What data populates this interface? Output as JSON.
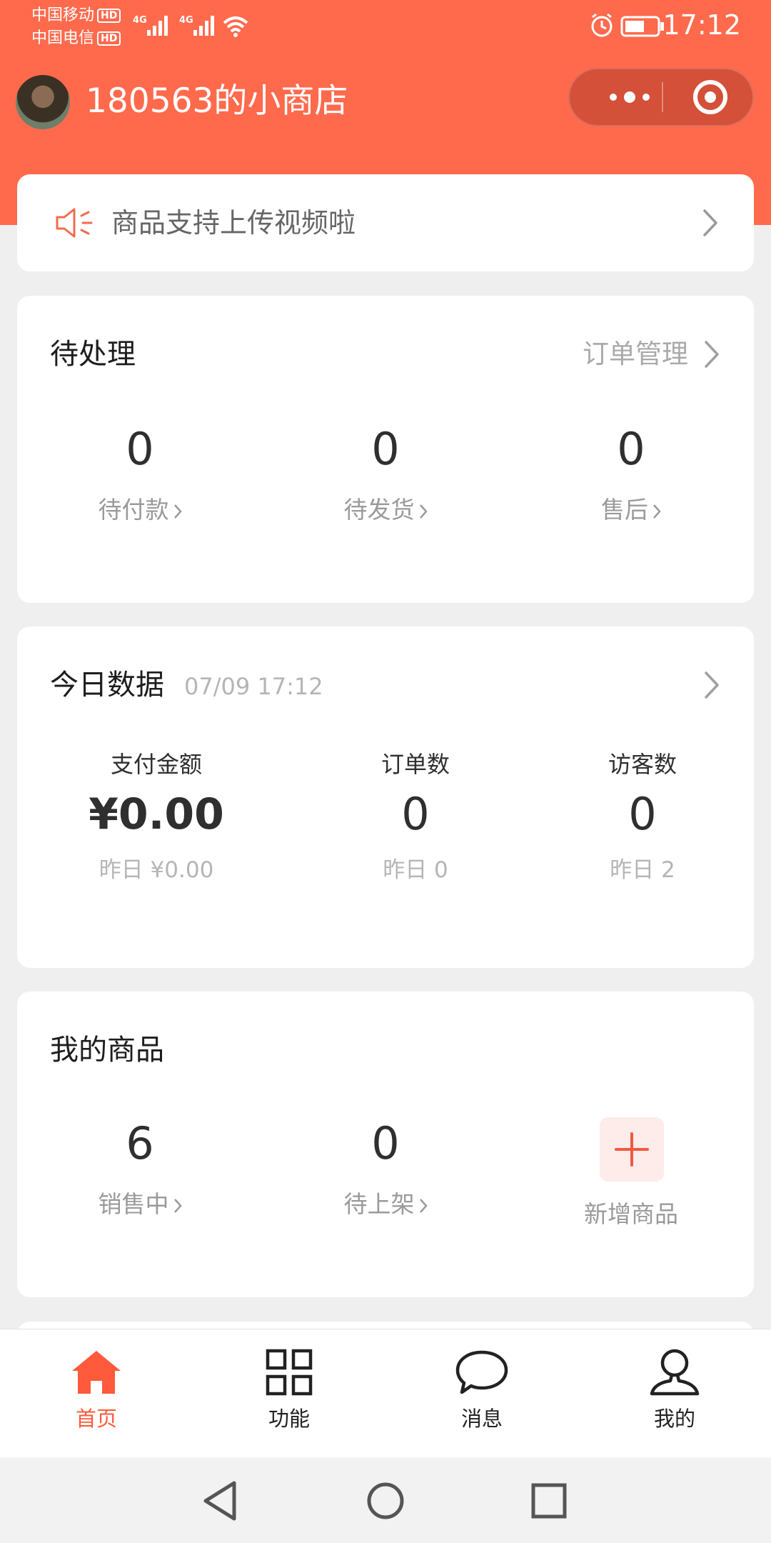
{
  "status_bar": {
    "carrier1": "中国移动",
    "carrier2": "中国电信",
    "hd": "HD",
    "net": "4G",
    "time": "17:12"
  },
  "header": {
    "shop_name": "180563的小商店"
  },
  "notice": {
    "text": "商品支持上传视频啦"
  },
  "pending": {
    "title": "待处理",
    "link": "订单管理",
    "items": [
      {
        "value": "0",
        "label": "待付款"
      },
      {
        "value": "0",
        "label": "待发货"
      },
      {
        "value": "0",
        "label": "售后"
      }
    ]
  },
  "today": {
    "title": "今日数据",
    "timestamp": "07/09 17:12",
    "stats": [
      {
        "label": "支付金额",
        "value": "¥0.00",
        "yesterday": "昨日 ¥0.00"
      },
      {
        "label": "订单数",
        "value": "0",
        "yesterday": "昨日 0"
      },
      {
        "label": "访客数",
        "value": "0",
        "yesterday": "昨日 2"
      }
    ]
  },
  "products": {
    "title": "我的商品",
    "items": [
      {
        "value": "6",
        "label": "销售中"
      },
      {
        "value": "0",
        "label": "待上架"
      }
    ],
    "add_label": "新增商品"
  },
  "tabbar": {
    "items": [
      {
        "label": "首页",
        "icon": "home-icon"
      },
      {
        "label": "功能",
        "icon": "grid-icon"
      },
      {
        "label": "消息",
        "icon": "chat-icon"
      },
      {
        "label": "我的",
        "icon": "person-icon"
      }
    ]
  },
  "colors": {
    "brand": "#ff6a4d",
    "accent": "#ff5a3c",
    "background": "#efefef"
  }
}
